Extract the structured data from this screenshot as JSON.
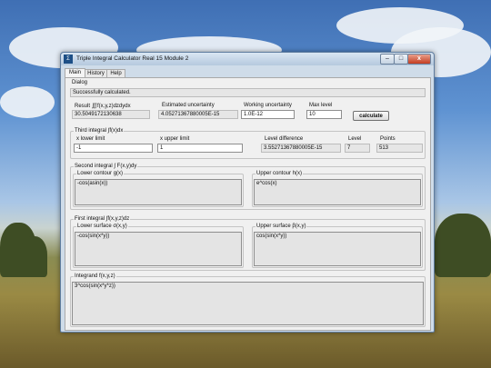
{
  "window": {
    "title": "Triple Integral Calculator Real 15 Module 2",
    "icon_glyph": "Σ"
  },
  "tabs": [
    {
      "label": "Main"
    },
    {
      "label": "History"
    },
    {
      "label": "Help"
    }
  ],
  "dialog": {
    "label": "Dialog",
    "message": "Successfully calculated."
  },
  "results": {
    "result_label": "Result ∭f(x,y,z)dzdydx",
    "result_value": "30.5049172130638",
    "est_unc_label": "Estimated uncertainty",
    "est_unc_value": "4.05271367880005E-15",
    "work_unc_label": "Working uncertainty",
    "work_unc_value": "1.0E-12",
    "max_level_label": "Max level",
    "max_level_value": "10",
    "calculate_label": "calculate"
  },
  "third": {
    "group_label": "Third integral  ∫f(x)dx",
    "x_lower_label": "x lower limit",
    "x_lower_value": "-1",
    "x_upper_label": "x upper limit",
    "x_upper_value": "1",
    "level_diff_label": "Level difference",
    "level_diff_value": "3.55271367880005E-15",
    "level_label": "Level",
    "level_value": "7",
    "points_label": "Points",
    "points_value": "513"
  },
  "second": {
    "group_label": "Second integral  ∫ F(x,y)dy",
    "lower_label": "Lower contour g(x)",
    "lower_value": "-cos(asin(x))",
    "upper_label": "Upper contour h(x)",
    "upper_value": "e^cos(x)"
  },
  "first": {
    "group_label": "First integral  ∫f(x,y,z)dz",
    "lower_label": "Lower surface σ(x,y)",
    "lower_value": "-cos(sin(x*y))",
    "upper_label": "Upper surface β(x,y)",
    "upper_value": "cos(sin(x*y))"
  },
  "integrand": {
    "label": "Integrand f(x,y,z)",
    "value": "3^cos(sin(x*y*z))"
  },
  "colors": {
    "accent": "#1d4f86",
    "close": "#c43c20"
  }
}
